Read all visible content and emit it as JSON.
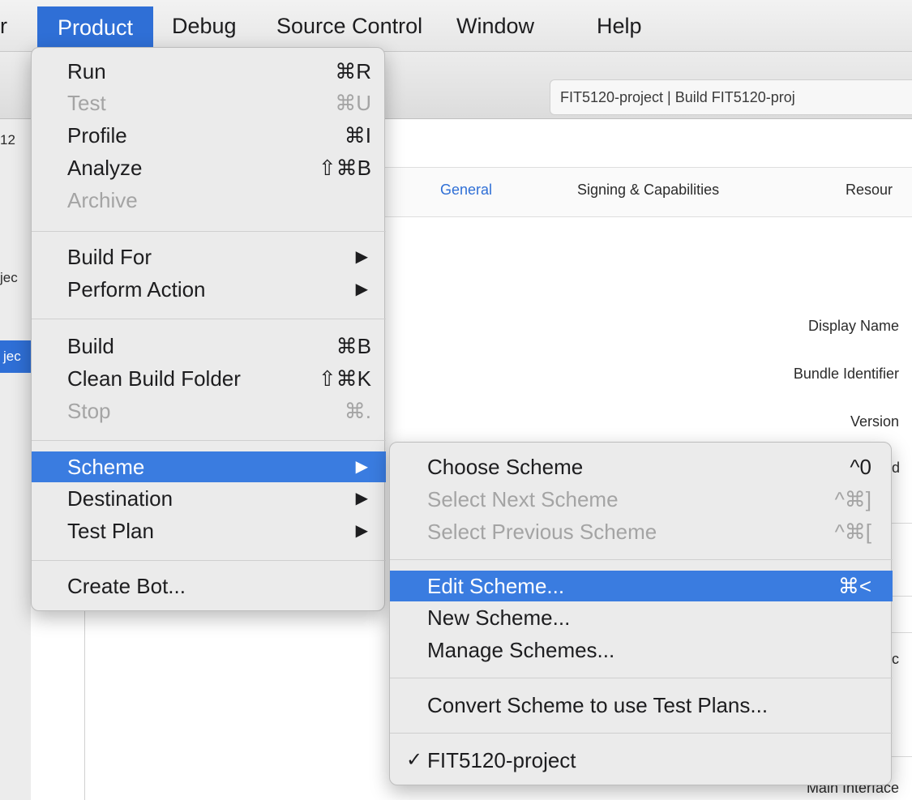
{
  "menubar": {
    "left_fragment": "r",
    "items": [
      "Product",
      "Debug",
      "Source Control",
      "Window",
      "Help"
    ]
  },
  "toolbar": {
    "activity_text": "FIT5120-project | Build FIT5120-proj"
  },
  "sidebar": {
    "fragments": [
      "12",
      "jec",
      "jec"
    ]
  },
  "editor": {
    "tabs": [
      "General",
      "Signing & Capabilities",
      "Resour"
    ],
    "active_tab": "General",
    "field_labels": [
      "Display Name",
      "Bundle Identifier",
      "Version",
      "Main Interface"
    ],
    "edge_fragments": [
      "d",
      "c"
    ]
  },
  "product_menu": {
    "groups": [
      [
        {
          "label": "Run",
          "shortcut": "⌘R",
          "enabled": true
        },
        {
          "label": "Test",
          "shortcut": "⌘U",
          "enabled": false
        },
        {
          "label": "Profile",
          "shortcut": "⌘I",
          "enabled": true
        },
        {
          "label": "Analyze",
          "shortcut": "⇧⌘B",
          "enabled": true
        },
        {
          "label": "Archive",
          "shortcut": "",
          "enabled": false
        }
      ],
      [
        {
          "label": "Build For",
          "submenu": true,
          "enabled": true
        },
        {
          "label": "Perform Action",
          "submenu": true,
          "enabled": true
        }
      ],
      [
        {
          "label": "Build",
          "shortcut": "⌘B",
          "enabled": true
        },
        {
          "label": "Clean Build Folder",
          "shortcut": "⇧⌘K",
          "enabled": true
        },
        {
          "label": "Stop",
          "shortcut": "⌘.",
          "enabled": false
        }
      ],
      [
        {
          "label": "Scheme",
          "submenu": true,
          "enabled": true,
          "highlighted": true
        },
        {
          "label": "Destination",
          "submenu": true,
          "enabled": true
        },
        {
          "label": "Test Plan",
          "submenu": true,
          "enabled": true
        }
      ],
      [
        {
          "label": "Create Bot...",
          "enabled": true
        }
      ]
    ]
  },
  "scheme_submenu": {
    "groups": [
      [
        {
          "label": "Choose Scheme",
          "shortcut": "^0",
          "enabled": true
        },
        {
          "label": "Select Next Scheme",
          "shortcut": "^⌘]",
          "enabled": false
        },
        {
          "label": "Select Previous Scheme",
          "shortcut": "^⌘[",
          "enabled": false
        }
      ],
      [
        {
          "label": "Edit Scheme...",
          "shortcut": "⌘<",
          "enabled": true,
          "highlighted": true
        },
        {
          "label": "New Scheme...",
          "enabled": true
        },
        {
          "label": "Manage Schemes...",
          "enabled": true
        }
      ],
      [
        {
          "label": "Convert Scheme to use Test Plans...",
          "enabled": true
        }
      ],
      [
        {
          "label": "FIT5120-project",
          "checked": true,
          "enabled": true
        }
      ]
    ],
    "check_mark": "✓"
  },
  "colors": {
    "accent": "#2f6fd6",
    "menu_highlight": "#3a7ce0",
    "menu_bg": "#ebebeb",
    "disabled_text": "#a4a4a4"
  }
}
